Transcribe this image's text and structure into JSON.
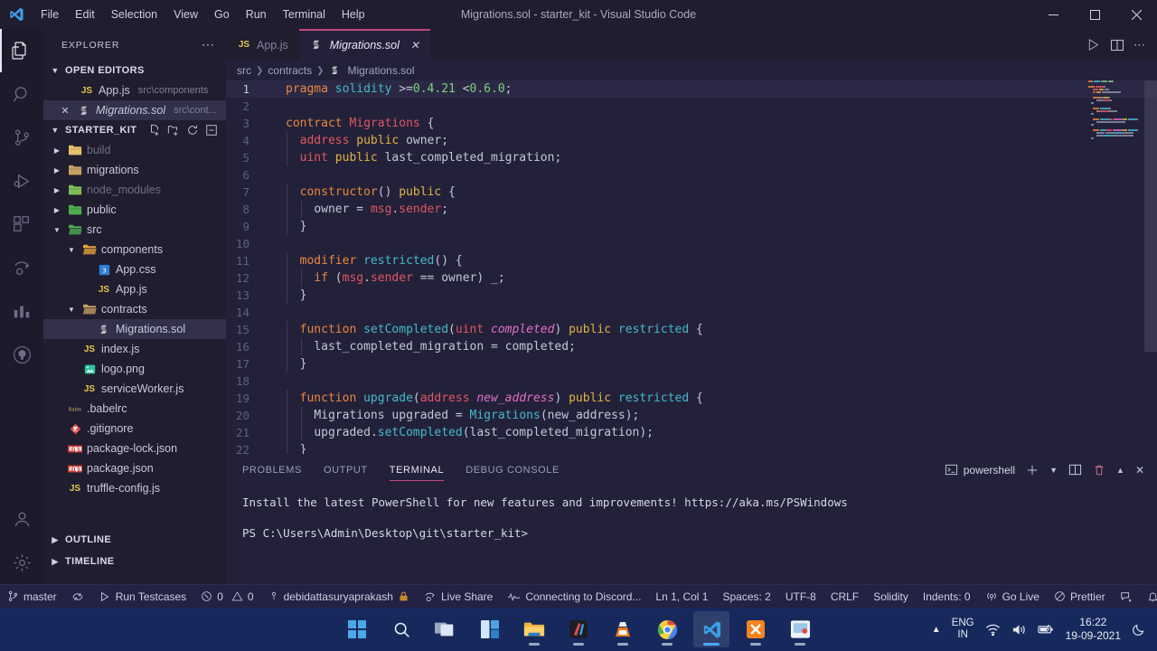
{
  "titlebar": {
    "title": "Migrations.sol - starter_kit - Visual Studio Code",
    "logo_icon": "vscode-logo-icon",
    "menus": [
      "File",
      "Edit",
      "Selection",
      "View",
      "Go",
      "Run",
      "Terminal",
      "Help"
    ],
    "minimize_icon": "minimize-icon",
    "maximize_icon": "maximize-icon",
    "close_icon": "close-icon"
  },
  "activitybar": {
    "items": [
      {
        "name": "explorer-icon",
        "active": true
      },
      {
        "name": "search-icon",
        "active": false
      },
      {
        "name": "source-control-icon",
        "active": false
      },
      {
        "name": "run-and-debug-icon",
        "active": false
      },
      {
        "name": "extensions-icon",
        "active": false
      },
      {
        "name": "live-share-icon",
        "active": false
      },
      {
        "name": "testing-icon",
        "active": false
      },
      {
        "name": "github-icon",
        "active": false
      }
    ],
    "bottom": [
      {
        "name": "accounts-icon"
      },
      {
        "name": "settings-gear-icon"
      }
    ]
  },
  "sidebar": {
    "header": "EXPLORER",
    "more_actions_icon": "ellipsis-icon",
    "open_editors": {
      "label": "OPEN EDITORS",
      "expanded": true,
      "items": [
        {
          "icon": "js-file-icon",
          "name": "App.js",
          "path": "src\\components",
          "selected": false,
          "dirty": false
        },
        {
          "icon": "solidity-file-icon",
          "name": "Migrations.sol",
          "path": "src\\cont...",
          "selected": true,
          "close_icon": "close-icon"
        }
      ]
    },
    "workspace": {
      "label": "STARTER_KIT",
      "expanded": true,
      "actions": [
        "new-file-icon",
        "new-folder-icon",
        "refresh-icon",
        "collapse-all-icon"
      ],
      "tree": [
        {
          "type": "folder",
          "name": "build",
          "depth": 1,
          "expanded": false,
          "dim": true,
          "color": "#e8c26b"
        },
        {
          "type": "folder",
          "name": "migrations",
          "depth": 1,
          "expanded": false,
          "dim": false,
          "color": "#c9a063"
        },
        {
          "type": "folder",
          "name": "node_modules",
          "depth": 1,
          "expanded": false,
          "dim": true,
          "color": "#7bbf5a"
        },
        {
          "type": "folder",
          "name": "public",
          "depth": 1,
          "expanded": false,
          "dim": false,
          "color": "#4caf50"
        },
        {
          "type": "folder",
          "name": "src",
          "depth": 1,
          "expanded": true,
          "dim": false,
          "color": "#4caf50"
        },
        {
          "type": "folder",
          "name": "components",
          "depth": 2,
          "expanded": true,
          "dim": false,
          "color": "#e8a33d"
        },
        {
          "type": "file",
          "name": "App.css",
          "depth": 3,
          "icon": "css-file-icon",
          "dim": false
        },
        {
          "type": "file",
          "name": "App.js",
          "depth": 3,
          "icon": "js-file-icon",
          "dim": false
        },
        {
          "type": "folder",
          "name": "contracts",
          "depth": 2,
          "expanded": true,
          "dim": false,
          "color": "#c9a063"
        },
        {
          "type": "file",
          "name": "Migrations.sol",
          "depth": 3,
          "icon": "solidity-file-icon",
          "selected": true,
          "dim": false
        },
        {
          "type": "file",
          "name": "index.js",
          "depth": 2,
          "icon": "js-file-icon",
          "dim": false
        },
        {
          "type": "file",
          "name": "logo.png",
          "depth": 2,
          "icon": "image-file-icon",
          "dim": false
        },
        {
          "type": "file",
          "name": "serviceWorker.js",
          "depth": 2,
          "icon": "js-file-icon",
          "dim": false
        },
        {
          "type": "file",
          "name": ".babelrc",
          "depth": 1,
          "icon": "babel-file-icon",
          "dim": false
        },
        {
          "type": "file",
          "name": ".gitignore",
          "depth": 1,
          "icon": "git-file-icon",
          "dim": false
        },
        {
          "type": "file",
          "name": "package-lock.json",
          "depth": 1,
          "icon": "npm-file-icon",
          "dim": false
        },
        {
          "type": "file",
          "name": "package.json",
          "depth": 1,
          "icon": "npm-file-icon",
          "dim": false
        },
        {
          "type": "file",
          "name": "truffle-config.js",
          "depth": 1,
          "icon": "js-file-icon",
          "dim": false
        }
      ]
    },
    "outline": {
      "label": "OUTLINE",
      "expanded": false
    },
    "timeline": {
      "label": "TIMELINE",
      "expanded": false
    }
  },
  "editor": {
    "tabs": [
      {
        "icon": "js-file-icon",
        "label": "App.js",
        "active": false
      },
      {
        "icon": "solidity-file-icon",
        "label": "Migrations.sol",
        "active": true,
        "close_icon": "close-icon"
      }
    ],
    "actions": [
      "run-icon",
      "split-editor-icon",
      "more-actions-icon"
    ],
    "breadcrumb": [
      "src",
      "contracts",
      "Migrations.sol"
    ],
    "breadcrumb_file_icon": "solidity-file-icon",
    "first_line": 1,
    "lines": [
      {
        "n": 1,
        "current": true,
        "tokens": [
          {
            "t": "pragma",
            "c": "k"
          },
          {
            "t": " ",
            "c": "op"
          },
          {
            "t": "solidity",
            "c": "fn"
          },
          {
            "t": " ",
            "c": "op"
          },
          {
            "t": ">=",
            "c": "op"
          },
          {
            "t": "0.4.21",
            "c": "num"
          },
          {
            "t": " ",
            "c": "op"
          },
          {
            "t": "<",
            "c": "op"
          },
          {
            "t": "0.6.0",
            "c": "num"
          },
          {
            "t": ";",
            "c": "op"
          }
        ]
      },
      {
        "n": 2,
        "tokens": []
      },
      {
        "n": 3,
        "tokens": [
          {
            "t": "contract",
            "c": "k"
          },
          {
            "t": " ",
            "c": "op"
          },
          {
            "t": "Migrations",
            "c": "tn"
          },
          {
            "t": " {",
            "c": "op"
          }
        ]
      },
      {
        "n": 4,
        "indent": 1,
        "tokens": [
          {
            "t": "  ",
            "c": "op"
          },
          {
            "t": "address",
            "c": "ty"
          },
          {
            "t": " ",
            "c": "op"
          },
          {
            "t": "public",
            "c": "vis"
          },
          {
            "t": " ",
            "c": "op"
          },
          {
            "t": "owner",
            "c": "id"
          },
          {
            "t": ";",
            "c": "op"
          }
        ]
      },
      {
        "n": 5,
        "indent": 1,
        "tokens": [
          {
            "t": "  ",
            "c": "op"
          },
          {
            "t": "uint",
            "c": "ty"
          },
          {
            "t": " ",
            "c": "op"
          },
          {
            "t": "public",
            "c": "vis"
          },
          {
            "t": " ",
            "c": "op"
          },
          {
            "t": "last_completed_migration",
            "c": "id"
          },
          {
            "t": ";",
            "c": "op"
          }
        ]
      },
      {
        "n": 6,
        "tokens": []
      },
      {
        "n": 7,
        "indent": 1,
        "tokens": [
          {
            "t": "  ",
            "c": "op"
          },
          {
            "t": "constructor",
            "c": "k"
          },
          {
            "t": "() ",
            "c": "op"
          },
          {
            "t": "public",
            "c": "vis"
          },
          {
            "t": " {",
            "c": "op"
          }
        ]
      },
      {
        "n": 8,
        "indent": 2,
        "tokens": [
          {
            "t": "    ",
            "c": "op"
          },
          {
            "t": "owner",
            "c": "id"
          },
          {
            "t": " = ",
            "c": "op"
          },
          {
            "t": "msg",
            "c": "ty"
          },
          {
            "t": ".",
            "c": "op"
          },
          {
            "t": "sender",
            "c": "ty"
          },
          {
            "t": ";",
            "c": "op"
          }
        ]
      },
      {
        "n": 9,
        "indent": 1,
        "tokens": [
          {
            "t": "  }",
            "c": "op"
          }
        ]
      },
      {
        "n": 10,
        "tokens": []
      },
      {
        "n": 11,
        "indent": 1,
        "tokens": [
          {
            "t": "  ",
            "c": "op"
          },
          {
            "t": "modifier",
            "c": "k"
          },
          {
            "t": " ",
            "c": "op"
          },
          {
            "t": "restricted",
            "c": "fn"
          },
          {
            "t": "() {",
            "c": "op"
          }
        ]
      },
      {
        "n": 12,
        "indent": 2,
        "tokens": [
          {
            "t": "    ",
            "c": "op"
          },
          {
            "t": "if",
            "c": "k"
          },
          {
            "t": " (",
            "c": "op"
          },
          {
            "t": "msg",
            "c": "ty"
          },
          {
            "t": ".",
            "c": "op"
          },
          {
            "t": "sender",
            "c": "ty"
          },
          {
            "t": " == ",
            "c": "op"
          },
          {
            "t": "owner",
            "c": "id"
          },
          {
            "t": ") _;",
            "c": "op"
          }
        ]
      },
      {
        "n": 13,
        "indent": 1,
        "tokens": [
          {
            "t": "  }",
            "c": "op"
          }
        ]
      },
      {
        "n": 14,
        "tokens": []
      },
      {
        "n": 15,
        "indent": 1,
        "tokens": [
          {
            "t": "  ",
            "c": "op"
          },
          {
            "t": "function",
            "c": "k"
          },
          {
            "t": " ",
            "c": "op"
          },
          {
            "t": "setCompleted",
            "c": "fn"
          },
          {
            "t": "(",
            "c": "op"
          },
          {
            "t": "uint",
            "c": "ty"
          },
          {
            "t": " ",
            "c": "op"
          },
          {
            "t": "completed",
            "c": "par"
          },
          {
            "t": ") ",
            "c": "op"
          },
          {
            "t": "public",
            "c": "vis"
          },
          {
            "t": " ",
            "c": "op"
          },
          {
            "t": "restricted",
            "c": "fn"
          },
          {
            "t": " {",
            "c": "op"
          }
        ]
      },
      {
        "n": 16,
        "indent": 2,
        "tokens": [
          {
            "t": "    ",
            "c": "op"
          },
          {
            "t": "last_completed_migration",
            "c": "id"
          },
          {
            "t": " = ",
            "c": "op"
          },
          {
            "t": "completed",
            "c": "id"
          },
          {
            "t": ";",
            "c": "op"
          }
        ]
      },
      {
        "n": 17,
        "indent": 1,
        "tokens": [
          {
            "t": "  }",
            "c": "op"
          }
        ]
      },
      {
        "n": 18,
        "tokens": []
      },
      {
        "n": 19,
        "indent": 1,
        "tokens": [
          {
            "t": "  ",
            "c": "op"
          },
          {
            "t": "function",
            "c": "k"
          },
          {
            "t": " ",
            "c": "op"
          },
          {
            "t": "upgrade",
            "c": "fn"
          },
          {
            "t": "(",
            "c": "op"
          },
          {
            "t": "address",
            "c": "ty"
          },
          {
            "t": " ",
            "c": "op"
          },
          {
            "t": "new_address",
            "c": "par"
          },
          {
            "t": ") ",
            "c": "op"
          },
          {
            "t": "public",
            "c": "vis"
          },
          {
            "t": " ",
            "c": "op"
          },
          {
            "t": "restricted",
            "c": "fn"
          },
          {
            "t": " {",
            "c": "op"
          }
        ]
      },
      {
        "n": 20,
        "indent": 2,
        "tokens": [
          {
            "t": "    ",
            "c": "op"
          },
          {
            "t": "Migrations",
            "c": "id"
          },
          {
            "t": " ",
            "c": "op"
          },
          {
            "t": "upgraded",
            "c": "id"
          },
          {
            "t": " = ",
            "c": "op"
          },
          {
            "t": "Migrations",
            "c": "fn"
          },
          {
            "t": "(",
            "c": "op"
          },
          {
            "t": "new_address",
            "c": "id"
          },
          {
            "t": ");",
            "c": "op"
          }
        ]
      },
      {
        "n": 21,
        "indent": 2,
        "tokens": [
          {
            "t": "    ",
            "c": "op"
          },
          {
            "t": "upgraded",
            "c": "id"
          },
          {
            "t": ".",
            "c": "op"
          },
          {
            "t": "setCompleted",
            "c": "fn"
          },
          {
            "t": "(",
            "c": "op"
          },
          {
            "t": "last_completed_migration",
            "c": "id"
          },
          {
            "t": ");",
            "c": "op"
          }
        ]
      },
      {
        "n": 22,
        "indent": 1,
        "tokens": [
          {
            "t": "  }",
            "c": "op"
          }
        ]
      }
    ]
  },
  "panel": {
    "tabs": [
      {
        "label": "PROBLEMS",
        "active": false
      },
      {
        "label": "OUTPUT",
        "active": false
      },
      {
        "label": "TERMINAL",
        "active": true
      },
      {
        "label": "DEBUG CONSOLE",
        "active": false
      }
    ],
    "shell": "powershell",
    "shell_icon": "terminal-icon",
    "actions": [
      "add-terminal-icon",
      "chevron-down-icon",
      "split-terminal-icon",
      "trash-icon",
      "chevron-up-icon",
      "close-icon"
    ],
    "terminal_lines": [
      "Install the latest PowerShell for new features and improvements! https://aka.ms/PSWindows",
      "",
      "PS C:\\Users\\Admin\\Desktop\\git\\starter_kit>"
    ]
  },
  "statusbar": {
    "left": [
      {
        "icon": "source-control-branch-icon",
        "label": "master"
      },
      {
        "icon": "sync-icon",
        "label": ""
      },
      {
        "icon": "play-icon",
        "label": "Run Testcases"
      },
      {
        "icon": "error-icon",
        "label": "0",
        "icon2": "warning-icon",
        "label2": "0"
      },
      {
        "icon": "account-icon",
        "label": "debidattasuryaprakash",
        "icon_after": "lock-icon"
      },
      {
        "icon": "live-share-icon",
        "label": "Live Share"
      },
      {
        "icon": "pulse-icon",
        "label": "Connecting to Discord..."
      }
    ],
    "right": [
      {
        "label": "Ln 1, Col 1"
      },
      {
        "label": "Spaces: 2"
      },
      {
        "label": "UTF-8"
      },
      {
        "label": "CRLF"
      },
      {
        "label": "Solidity"
      },
      {
        "label": "Indents: 0"
      },
      {
        "icon": "broadcast-icon",
        "label": "Go Live"
      },
      {
        "icon": "prettier-icon",
        "label": "Prettier"
      },
      {
        "icon": "feedback-icon",
        "label": ""
      },
      {
        "icon": "bell-icon",
        "label": ""
      }
    ]
  },
  "taskbar": {
    "items": [
      {
        "name": "start-button-icon"
      },
      {
        "name": "search-taskbar-icon"
      },
      {
        "name": "task-view-icon"
      },
      {
        "name": "widgets-icon"
      },
      {
        "name": "file-explorer-icon",
        "running": true
      },
      {
        "name": "paint-icon",
        "running": true
      },
      {
        "name": "vlc-icon",
        "running": true
      },
      {
        "name": "chrome-icon",
        "running": true
      },
      {
        "name": "vscode-taskbar-icon",
        "running": true,
        "active": true
      },
      {
        "name": "xampp-icon",
        "running": true
      },
      {
        "name": "screen-recorder-icon",
        "running": true
      }
    ],
    "tray": {
      "overflow_icon": "chevron-up-icon",
      "language": "ENG",
      "region": "IN",
      "wifi_icon": "wifi-icon",
      "volume_icon": "volume-icon",
      "battery_icon": "battery-icon",
      "time": "16:22",
      "date": "19-09-2021",
      "notification_icon": "moon-icon"
    }
  },
  "colors": {
    "accent_pink": "#c0487f",
    "editor_bg": "#23213a",
    "sidebar_bg": "#1f1d2e",
    "titlebar_bg": "#1f1d2e",
    "statusbar_bg": "#232144",
    "taskbar_bg": "#17295c"
  }
}
